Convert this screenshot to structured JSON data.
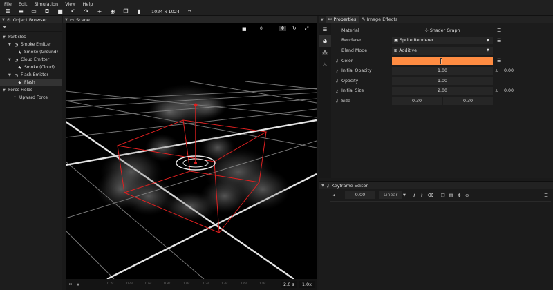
{
  "menu": [
    "File",
    "Edit",
    "Simulation",
    "View",
    "Help"
  ],
  "toolbar": {
    "icons": [
      "menu-bars-icon",
      "new-file-icon",
      "open-folder-icon",
      "save-icon",
      "video-camera-icon",
      "undo-icon",
      "redo-icon",
      "add-icon",
      "visibility-eye-icon",
      "duplicate-icon",
      "delete-icon",
      "crop-icon"
    ],
    "resolution": "1024 x 1024"
  },
  "object_browser": {
    "title": "Object Browser",
    "tree": [
      {
        "label": "Particles",
        "level": 0,
        "expanded": true,
        "icon": "none"
      },
      {
        "label": "Smoke Emitter",
        "level": 1,
        "expanded": true,
        "icon": "emitter-icon"
      },
      {
        "label": "Smoke (Ground)",
        "level": 2,
        "icon": "particle-star-icon"
      },
      {
        "label": "Cloud Emitter",
        "level": 1,
        "expanded": true,
        "icon": "emitter-icon"
      },
      {
        "label": "Smoke (Cloud)",
        "level": 2,
        "icon": "particle-star-icon"
      },
      {
        "label": "Flash Emitter",
        "level": 1,
        "expanded": true,
        "icon": "emitter-icon"
      },
      {
        "label": "Flash",
        "level": 2,
        "icon": "particle-star-icon",
        "selected": true
      },
      {
        "label": "Force Fields",
        "level": 0,
        "expanded": true,
        "icon": "none"
      },
      {
        "label": "Upward Force",
        "level": 1,
        "icon": "upward-force-icon"
      }
    ]
  },
  "scene": {
    "title": "Scene",
    "camera_index": "0",
    "timeline": {
      "ticks": [
        "0.2s",
        "0.4s",
        "0.6s",
        "0.8s",
        "1.0s",
        "1.2s",
        "1.4s",
        "1.6s",
        "1.8s"
      ],
      "duration": "2.0 s",
      "speed": "1.0x"
    }
  },
  "properties": {
    "tabs": [
      "Properties",
      "Image Effects"
    ],
    "material_label": "Material",
    "material_value": "Shader Graph",
    "renderer_label": "Renderer",
    "renderer_value": "Sprite Renderer",
    "blend_label": "Blend Mode",
    "blend_value": "Additive",
    "color_label": "Color",
    "color_hex": "#ff8c42",
    "initial_opacity_label": "Initial Opacity",
    "initial_opacity_value": "1.00",
    "initial_opacity_variance": "0.00",
    "opacity_label": "Opacity",
    "opacity_value": "1.00",
    "initial_size_label": "Initial Size",
    "initial_size_value": "2.00",
    "initial_size_variance": "0.00",
    "size_label": "Size",
    "size_min": "0.30",
    "size_max": "0.30",
    "plus_minus": "±"
  },
  "keyframe_editor": {
    "title": "Keyframe Editor",
    "value": "0.00",
    "interpolation": "Linear"
  }
}
